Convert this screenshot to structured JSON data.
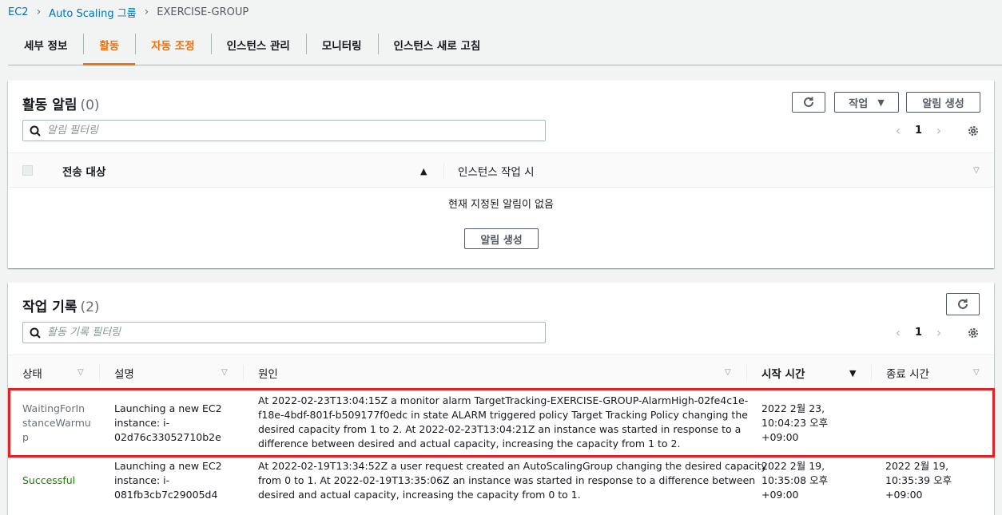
{
  "breadcrumb": {
    "items": [
      "EC2",
      "Auto Scaling 그룹"
    ],
    "current": "EXERCISE-GROUP"
  },
  "tabs": [
    "세부 정보",
    "활동",
    "자동 조정",
    "인스턴스 관리",
    "모니터링",
    "인스턴스 새로 고침"
  ],
  "active_tab": "활동",
  "alarms_panel": {
    "title": "활동 알림",
    "count": "(0)",
    "actions_label": "작업",
    "create_label": "알림 생성",
    "filter_placeholder": "알림 필터링",
    "page": "1",
    "columns": [
      "전송 대상",
      "인스턴스 작업 시"
    ],
    "empty_text": "현재 지정된 알림이 없음",
    "empty_button": "알림 생성"
  },
  "history_panel": {
    "title": "작업 기록",
    "count": "(2)",
    "filter_placeholder": "활동 기록 필터링",
    "page": "1",
    "columns": [
      "상태",
      "설명",
      "원인",
      "시작 시간",
      "종료 시간"
    ],
    "rows": [
      {
        "status": "WaitingForIn stanceWarmu p",
        "status_lines": [
          "WaitingForIn",
          "stanceWarmu",
          "p"
        ],
        "description_lines": [
          "Launching a new EC2",
          "instance: i-",
          "02d76c33052710b2e"
        ],
        "cause_lines": [
          "At 2022-02-23T13:04:15Z a monitor alarm TargetTracking-EXERCISE-GROUP-AlarmHigh-02fe4c1e-",
          "f18e-4bdf-801f-b509177f0edc in state ALARM triggered policy Target Tracking Policy changing the",
          "desired capacity from 1 to 2. At 2022-02-23T13:04:21Z an instance was started in response to a",
          "difference between desired and actual capacity, increasing the capacity from 1 to 2."
        ],
        "start_lines": [
          "2022 2월 23,",
          "10:04:23 오후",
          "+09:00"
        ],
        "end_lines": [
          "",
          "",
          ""
        ]
      },
      {
        "status": "Successful",
        "status_lines": [
          "Successful"
        ],
        "description_lines": [
          "Launching a new EC2",
          "instance: i-",
          "081fb3cb7c29005d4"
        ],
        "cause_lines": [
          "At 2022-02-19T13:34:52Z a user request created an AutoScalingGroup changing the desired capacity",
          "from 0 to 1. At 2022-02-19T13:35:06Z an instance was started in response to a difference between",
          "desired and actual capacity, increasing the capacity from 0 to 1."
        ],
        "start_lines": [
          "2022 2월 19,",
          "10:35:08 오후",
          "+09:00"
        ],
        "end_lines": [
          "2022 2월 19,",
          "10:35:39 오후",
          "+09:00"
        ]
      }
    ]
  },
  "colors": {
    "accent": "#ec7211",
    "link": "#0073bb",
    "success": "#1d8102",
    "highlight": "#e32227"
  }
}
